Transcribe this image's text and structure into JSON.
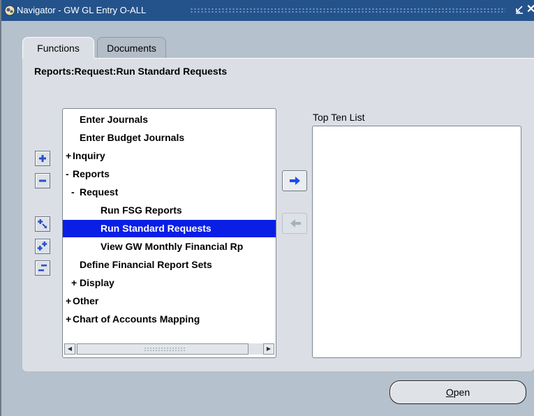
{
  "window": {
    "title": "Navigator - GW GL Entry O-ALL",
    "close_glyph": "✕"
  },
  "tabs": [
    {
      "label": "Functions",
      "active": true
    },
    {
      "label": "Documents",
      "active": false
    }
  ],
  "breadcrumb": "Reports:Request:Run Standard Requests",
  "tree": {
    "items": [
      {
        "prefix": "",
        "label": "Enter Journals",
        "level": 1,
        "selected": false
      },
      {
        "prefix": "",
        "label": "Enter Budget Journals",
        "level": 1,
        "selected": false
      },
      {
        "prefix": "+",
        "label": "Inquiry",
        "level": 0,
        "selected": false
      },
      {
        "prefix": "-",
        "label": "Reports",
        "level": 0,
        "selected": false
      },
      {
        "prefix": "-",
        "label": "Request",
        "level": 1,
        "selected": false
      },
      {
        "prefix": "",
        "label": "Run FSG Reports",
        "level": 2,
        "selected": false
      },
      {
        "prefix": "",
        "label": "Run Standard Requests",
        "level": 2,
        "selected": true
      },
      {
        "prefix": "",
        "label": "View GW Monthly Financial Rp",
        "level": 2,
        "selected": false
      },
      {
        "prefix": "",
        "label": "Define Financial Report Sets",
        "level": 1,
        "selected": false
      },
      {
        "prefix": "+",
        "label": "Display",
        "level": 1,
        "selected": false
      },
      {
        "prefix": "+",
        "label": "Other",
        "level": 0,
        "selected": false
      },
      {
        "prefix": "+",
        "label": "Chart of Accounts Mapping",
        "level": 0,
        "selected": false
      }
    ],
    "scroll_left_glyph": "◀",
    "scroll_right_glyph": "▶"
  },
  "tree_tools": {
    "expand_icon": "plus-icon",
    "collapse_icon": "minus-icon",
    "expand_branch_icon": "expand-branch-icon",
    "expand_all_icon": "expand-all-icon",
    "collapse_all_icon": "collapse-all-icon"
  },
  "top_ten": {
    "label": "Top Ten List",
    "items": []
  },
  "buttons": {
    "add_icon": "arrow-right-icon",
    "remove_icon": "arrow-left-icon",
    "open_mnemonic": "O",
    "open_rest": "pen"
  },
  "colors": {
    "titlebar": "#24538c",
    "selection": "#0a1ee6",
    "accent_arrow": "#1650e8"
  }
}
